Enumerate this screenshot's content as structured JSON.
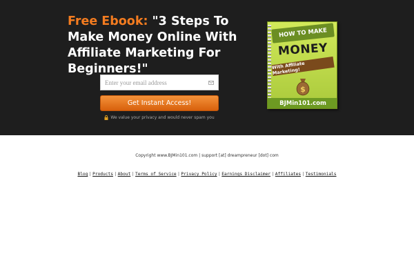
{
  "hero": {
    "headline_accent": "Free Ebook:",
    "headline_rest": " \"3 Steps To Make Money Online With Affiliate Marketing For Beginners!\"",
    "email_placeholder": "Enter your email address",
    "cta_label": "Get Instant Access!",
    "privacy_text": "We value your privacy and would never spam you"
  },
  "cover": {
    "banner": "HOW TO MAKE",
    "title": "MONEY",
    "ribbon": "With Affiliate Marketing!",
    "footer": "BJMin101.com"
  },
  "footer": {
    "copyright": "Copyright www.BJMin101.com | support [at] dreampreneur [dot] com",
    "links": [
      "Blog",
      "Products",
      "About",
      "Terms of Service",
      "Privacy Policy",
      "Earnings Disclaimer",
      "Affiliates",
      "Testimonials"
    ],
    "separator": "|"
  },
  "colors": {
    "hero_bg": "#1e1e1e",
    "accent": "#f47c20",
    "cover_green": "#a9c93b"
  },
  "icons": [
    "mail-icon",
    "lock-icon",
    "money-bag-icon"
  ]
}
